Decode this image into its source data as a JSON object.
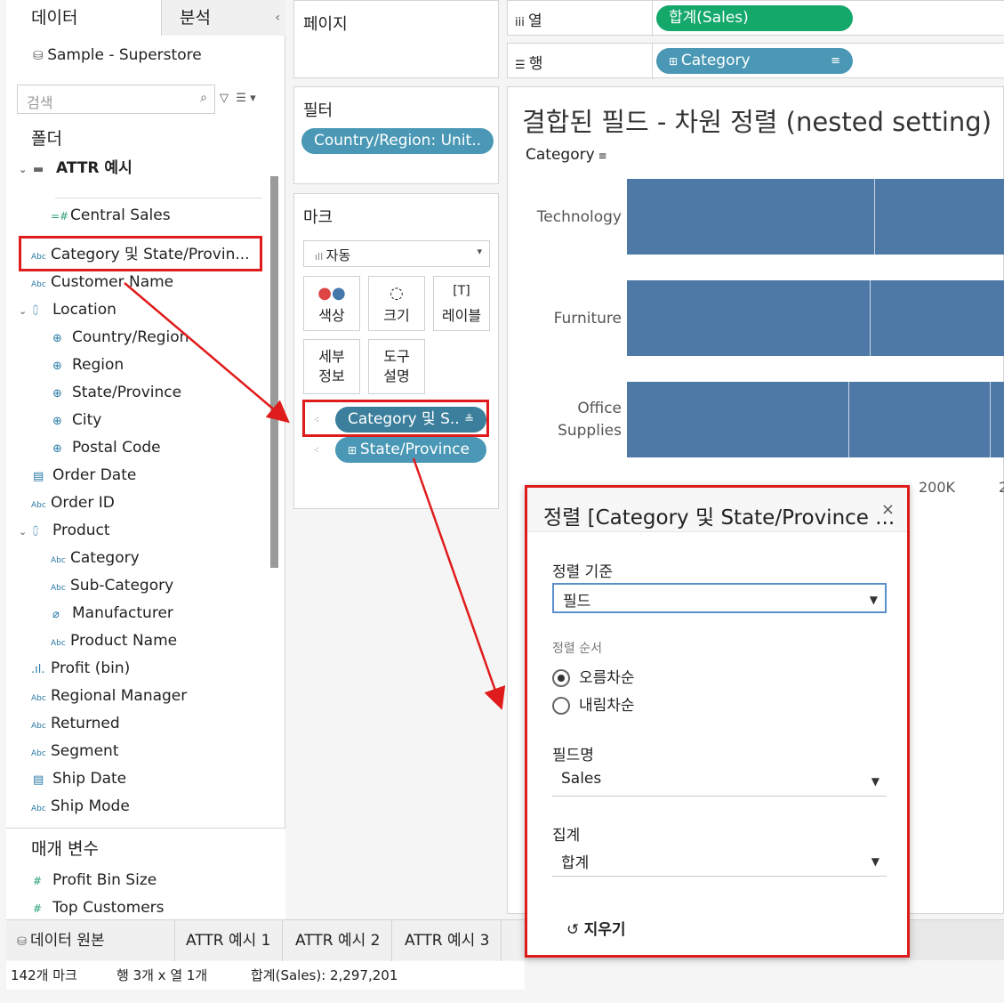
{
  "data_pane": {
    "tab_data": "데이터",
    "tab_analysis": "분석",
    "collapse": "‹",
    "source": "Sample - Superstore",
    "search_placeholder": "검색",
    "folders_header": "폴더",
    "folder_attr": "ATTR 예시",
    "fields": {
      "central_sales": "Central Sales",
      "category_state": "Category 및 State/Provin...",
      "customer_name": "Customer Name",
      "location": "Location",
      "country_region": "Country/Region",
      "region": "Region",
      "state_province": "State/Province",
      "city": "City",
      "postal_code": "Postal Code",
      "order_date": "Order Date",
      "order_id": "Order ID",
      "product": "Product",
      "category": "Category",
      "sub_category": "Sub-Category",
      "manufacturer": "Manufacturer",
      "product_name": "Product Name",
      "profit_bin": "Profit (bin)",
      "regional_manager": "Regional Manager",
      "returned": "Returned",
      "segment": "Segment",
      "ship_date": "Ship Date",
      "ship_mode": "Ship Mode"
    },
    "params_header": "매개 변수",
    "params": [
      "Profit Bin Size",
      "Top Customers"
    ]
  },
  "shelves": {
    "pages": "페이지",
    "filters": "필터",
    "filter_pill": "Country/Region: Unit..",
    "marks": "마크",
    "mark_type": "자동",
    "mark_buttons": {
      "color": "색상",
      "size": "크기",
      "label": "레이블",
      "detail_1": "세부",
      "detail_2": "정보",
      "tooltip_1": "도구",
      "tooltip_2": "설명"
    },
    "mark_pill_1": "Category 및 S..",
    "mark_pill_2": "State/Province",
    "columns_label": "열",
    "columns_pill": "합계(Sales)",
    "rows_label": "행",
    "rows_pill": "Category"
  },
  "viz": {
    "title": "결합된 필드 - 차원 정렬 (nested setting)",
    "header": "Category"
  },
  "chart_data": {
    "type": "bar",
    "categories": [
      "Technology",
      "Furniture",
      "Office Supplies"
    ],
    "tick_labels": [
      "200K",
      "2"
    ]
  },
  "dialog": {
    "title": "정렬 [Category 및 State/Province ...",
    "close": "×",
    "sort_by_label": "정렬 기준",
    "sort_by_value": "필드",
    "sort_order_label": "정렬 순서",
    "ascending": "오름차순",
    "descending": "내림차순",
    "field_name_label": "필드명",
    "field_name_value": "Sales",
    "aggregation_label": "집계",
    "aggregation_value": "합계",
    "clear": "지우기"
  },
  "sheet_tabs": [
    "데이터 원본",
    "ATTR 예시 1",
    "ATTR 예시 2",
    "ATTR 예시 3"
  ],
  "status": {
    "marks": "142개 마크",
    "rows_cols": "행 3개 x 열 1개",
    "sum": "합계(Sales): 2,297,201"
  },
  "colors": {
    "accent_blue": "#4e79a7",
    "pill_blue": "#4a98b5",
    "pill_green": "#14a86b",
    "highlight_red": "#e01b1b"
  }
}
